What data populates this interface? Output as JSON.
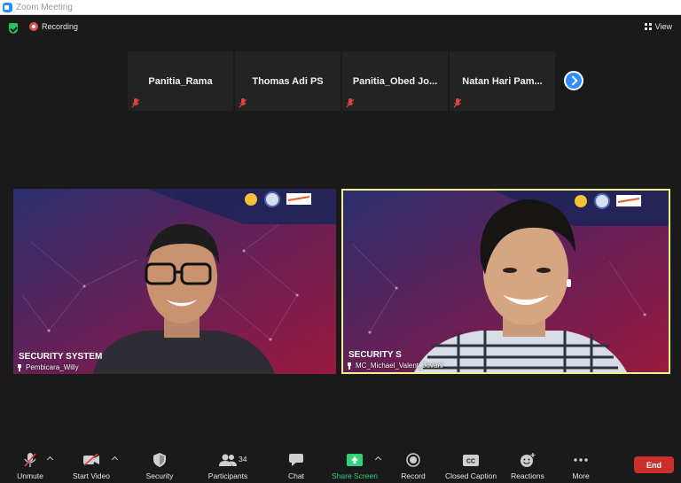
{
  "window": {
    "title": "Zoom Meeting"
  },
  "topbar": {
    "recording_label": "Recording",
    "view_label": "View"
  },
  "thumbnails": [
    {
      "name": "Panitia_Rama"
    },
    {
      "name": "Thomas Adi PS"
    },
    {
      "name": "Panitia_Obed  Jo..."
    },
    {
      "name": "Natan  Hari  Pam..."
    }
  ],
  "videos": [
    {
      "name": "Pembicara_Willy",
      "banner": "SECURITY SYSTEM"
    },
    {
      "name": "MC_Michael_Valent_Jovani",
      "banner": "SECURITY S"
    }
  ],
  "toolbar": {
    "unmute": "Unmute",
    "start_video": "Start Video",
    "security": "Security",
    "participants": "Participants",
    "participant_count": "34",
    "chat": "Chat",
    "share_screen": "Share Screen",
    "record": "Record",
    "closed_caption": "Closed Caption",
    "reactions": "Reactions",
    "more": "More",
    "end": "End"
  },
  "colors": {
    "accent": "#2d8cff",
    "active_speaker": "#f3f08a",
    "share_green": "#33d17a",
    "end_red": "#c9302c"
  }
}
